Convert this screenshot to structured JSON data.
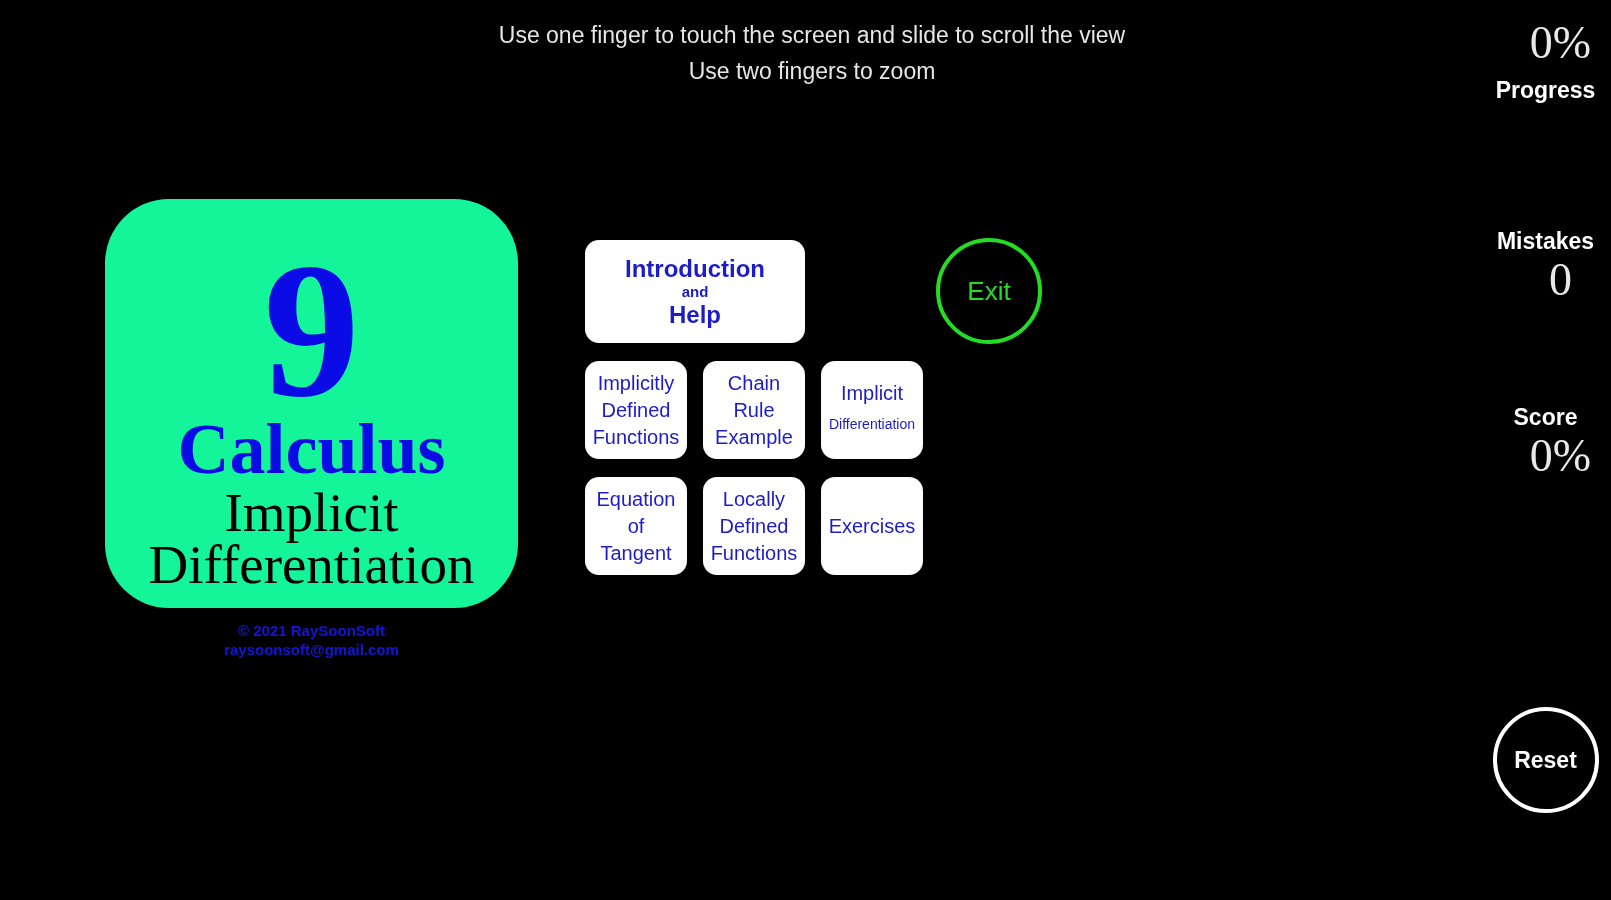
{
  "instructions": [
    "Use one finger to touch the screen and slide to scroll the view",
    "Use two fingers to zoom"
  ],
  "title_card": {
    "number": "9",
    "subject": "Calculus",
    "topic_lines": [
      "Implicit",
      "Differentiation"
    ]
  },
  "copyright": [
    "© 2021 RaySoonSoft",
    "raysoonsoft@gmail.com"
  ],
  "menu_buttons": [
    {
      "kind": "wide",
      "lines": [
        {
          "text": "Introduction",
          "kind": "main"
        },
        {
          "text": "and",
          "kind": "small"
        },
        {
          "text": "Help",
          "kind": "main"
        }
      ]
    },
    {
      "kind": "tile",
      "lines": [
        {
          "text": "Implicitly",
          "kind": "main"
        },
        {
          "text": "Defined",
          "kind": "main"
        },
        {
          "text": "Functions",
          "kind": "main"
        }
      ]
    },
    {
      "kind": "tile",
      "lines": [
        {
          "text": "Chain",
          "kind": "main"
        },
        {
          "text": "Rule",
          "kind": "main"
        },
        {
          "text": "Example",
          "kind": "main"
        }
      ]
    },
    {
      "kind": "tile",
      "lines": [
        {
          "text": "Implicit",
          "kind": "main"
        },
        {
          "text": "Differentiation",
          "kind": "small"
        }
      ]
    },
    {
      "kind": "tile",
      "lines": [
        {
          "text": "Equation",
          "kind": "main"
        },
        {
          "text": "of",
          "kind": "main"
        },
        {
          "text": "Tangent",
          "kind": "main"
        }
      ]
    },
    {
      "kind": "tile",
      "lines": [
        {
          "text": "Locally",
          "kind": "main"
        },
        {
          "text": "Defined",
          "kind": "main"
        },
        {
          "text": "Functions",
          "kind": "main"
        }
      ]
    },
    {
      "kind": "tile",
      "lines": [
        {
          "text": "Exercises",
          "kind": "main"
        }
      ]
    }
  ],
  "exit_button": {
    "label": "Exit"
  },
  "stats": [
    {
      "kind": "caption",
      "value": "0%",
      "label": "Progress"
    },
    {
      "kind": "heading",
      "label": "Mistakes",
      "value": "0"
    },
    {
      "kind": "heading",
      "label": "Score",
      "value": "0%"
    }
  ],
  "reset_button": {
    "label": "Reset"
  }
}
